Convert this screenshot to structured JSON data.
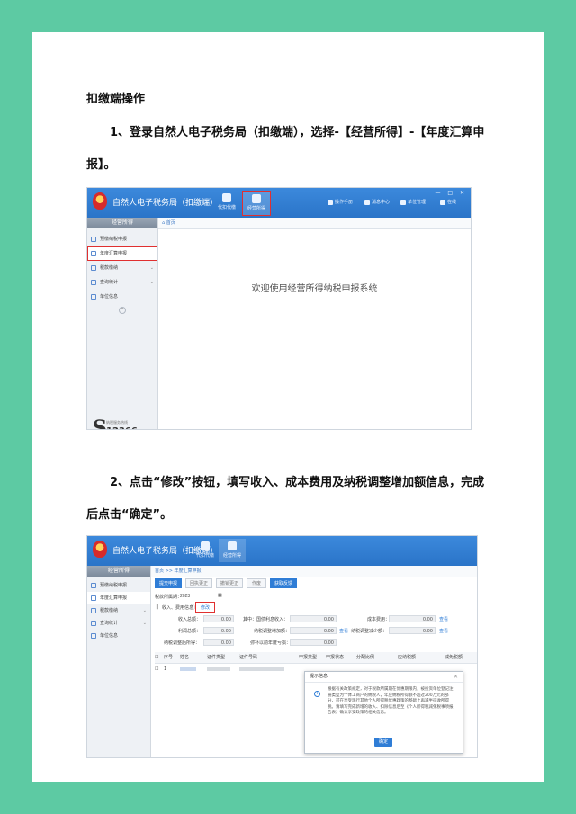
{
  "document": {
    "heading": "扣缴端操作",
    "step1": "1、登录自然人电子税务局（扣缴端），选择-【经营所得】-【年度汇算申报】。",
    "step2": "2、点击“修改”按钮，填写收入、成本费用及纳税调整增加额信息，完成后点击“确定”。"
  },
  "screenshot1": {
    "app_title": "自然人电子税务局（扣缴端）",
    "toolbar": [
      "代扣代缴",
      "经营所得"
    ],
    "top_right": [
      "操作手册",
      "消息中心",
      "单位管理",
      "在线"
    ],
    "sidebar_head": "经营所得",
    "sidebar_items": [
      "预缴纳税申报",
      "年度汇算申报",
      "税款缴纳",
      "查询统计",
      "单位信息"
    ],
    "tab": "首页",
    "welcome": "欢迎使用经营所得纳税申报系统",
    "hotline_caption": "纳税服务热线",
    "hotline_number": "12366"
  },
  "screenshot2": {
    "app_title": "自然人电子税务局（扣缴端）",
    "toolbar": [
      "代扣代缴",
      "经营所得"
    ],
    "sidebar_head": "经营所得",
    "sidebar_items": [
      "预缴纳税申报",
      "年度汇算申报",
      "税款缴纳",
      "查询统计",
      "单位信息"
    ],
    "breadcrumb": "首页 >> 年度汇算申报",
    "actions": [
      "提交申报",
      "回执更正",
      "撤销更正",
      "作废",
      "获取反馈"
    ],
    "period_label": "税款所属期：",
    "period_value": "2023",
    "section_label": "收入、费用信息",
    "edit_link": "修改",
    "fields": [
      {
        "label": "收入总额：",
        "value": "0.00"
      },
      {
        "label": "其中：国债利息收入：",
        "value": "0.00"
      },
      {
        "label": "成本费用：",
        "value": "0.00"
      },
      {
        "label": "利润总额：",
        "value": "0.00"
      },
      {
        "label": "纳税调整增加额：",
        "value": "0.00"
      },
      {
        "label": "纳税调整减少额：",
        "value": "0.00"
      },
      {
        "label": "纳税调整后所得：",
        "value": "0.00"
      },
      {
        "label": "弥补以前年度亏损：",
        "value": "0.00"
      }
    ],
    "view_link": "查看",
    "table_headers": [
      "序号",
      "姓名",
      "证件类型",
      "证件号码",
      "申报类型",
      "申报状态",
      "分配比例",
      "应纳税额",
      "减免税额"
    ],
    "table_row": [
      "1"
    ],
    "dialog_title": "提示信息",
    "dialog_text": "根据有关政策规定，对于税款所属期在优惠期限内，被投资单位登记注册类型为个体工商户的纳税人，年应纳税所得额不超过200万元的部分，可在享受现行其他个人所得税优惠政策的基础上再减半征收所得税。请填写完成新增的收入、扣除信息后至《个人所得税减免税事项报告表》确认享受政策的相关信息。",
    "dialog_ok": "确定"
  }
}
